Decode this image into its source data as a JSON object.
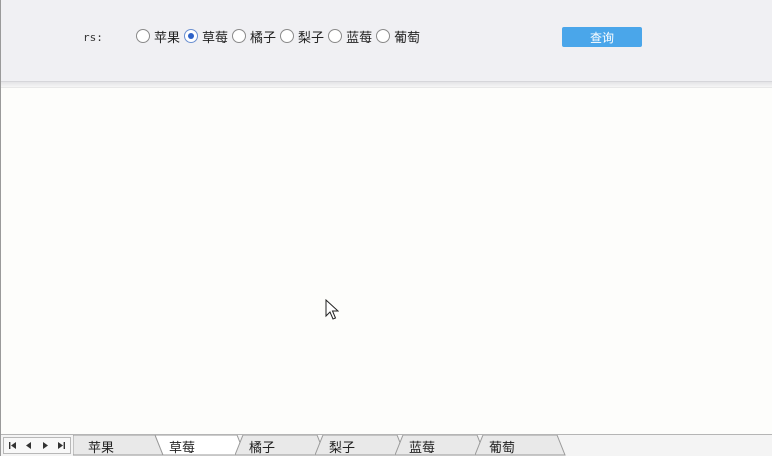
{
  "filter": {
    "label": "rs:",
    "options": [
      {
        "label": "苹果",
        "checked": false
      },
      {
        "label": "草莓",
        "checked": true
      },
      {
        "label": "橘子",
        "checked": false
      },
      {
        "label": "梨子",
        "checked": false
      },
      {
        "label": "蓝莓",
        "checked": false
      },
      {
        "label": "葡萄",
        "checked": false
      }
    ],
    "query_button": "查询"
  },
  "sheet_tabs": {
    "tabs": [
      {
        "label": "苹果",
        "active": false
      },
      {
        "label": "草莓",
        "active": true
      },
      {
        "label": "橘子",
        "active": false
      },
      {
        "label": "梨子",
        "active": false
      },
      {
        "label": "蓝莓",
        "active": false
      },
      {
        "label": "葡萄",
        "active": false
      }
    ],
    "nav_icons": [
      "first-sheet-icon",
      "prev-sheet-icon",
      "next-sheet-icon",
      "last-sheet-icon"
    ]
  },
  "colors": {
    "query_button_bg": "#4aa6ea",
    "radio_checked": "#2d62c8",
    "filter_bar_bg": "#f0f0f3"
  }
}
